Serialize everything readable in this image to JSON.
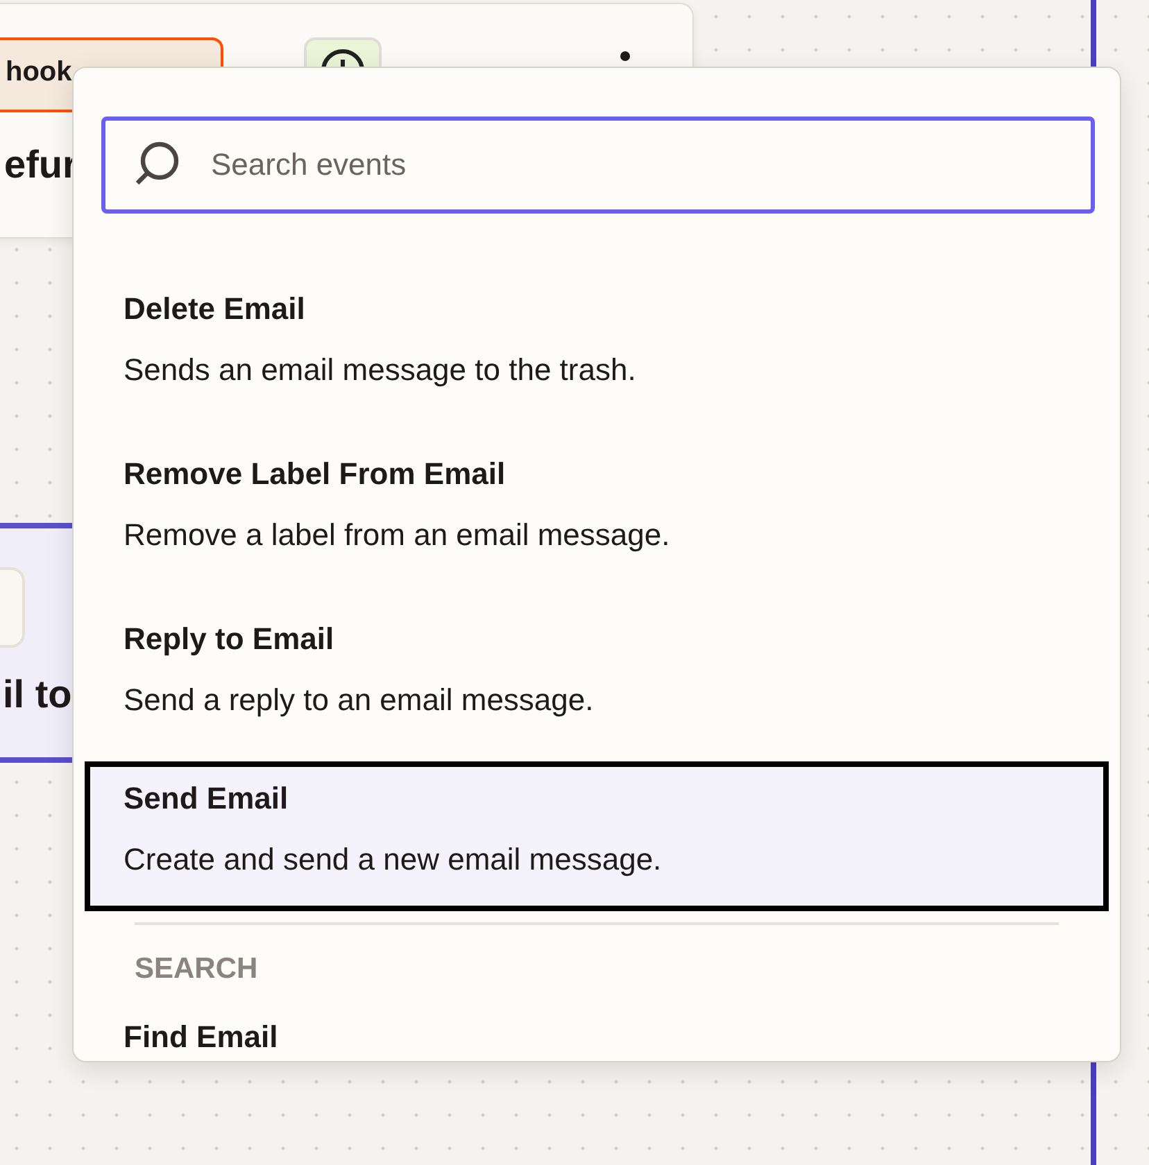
{
  "background_steps": [
    {
      "app_label": "hook",
      "title": "efur",
      "kind": "trigger"
    },
    {
      "title": "il to",
      "kind": "action"
    }
  ],
  "search": {
    "placeholder": "Search events"
  },
  "events": [
    {
      "title": "Delete Email",
      "description": "Sends an email message to the trash.",
      "selected": false
    },
    {
      "title": "Remove Label From Email",
      "description": "Remove a label from an email message.",
      "selected": false
    },
    {
      "title": "Reply to Email",
      "description": "Send a reply to an email message.",
      "selected": false
    },
    {
      "title": "Send Email",
      "description": "Create and send a new email message.",
      "selected": true
    }
  ],
  "sections": [
    {
      "header": "SEARCH",
      "items": [
        {
          "title": "Find Email"
        }
      ]
    }
  ]
}
